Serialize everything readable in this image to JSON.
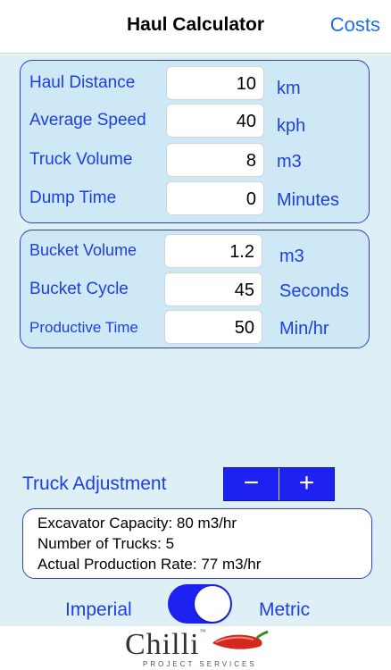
{
  "nav": {
    "title": "Haul Calculator",
    "right_button": "Costs"
  },
  "haul": {
    "distance": {
      "label": "Haul Distance",
      "value": "10",
      "unit": "km"
    },
    "speed": {
      "label": "Average Speed",
      "value": "40",
      "unit": "kph"
    },
    "truck_volume": {
      "label": "Truck Volume",
      "value": "8",
      "unit": "m3"
    },
    "dump_time": {
      "label": "Dump Time",
      "value": "0",
      "unit": "Minutes"
    }
  },
  "excavator": {
    "bucket_volume": {
      "label": "Bucket Volume",
      "value": "1.2",
      "unit": "m3"
    },
    "bucket_cycle": {
      "label": "Bucket Cycle",
      "value": "45",
      "unit": "Seconds"
    },
    "productive_time": {
      "label": "Productive Time",
      "value": "50",
      "unit": "Min/hr"
    }
  },
  "adjustment": {
    "label": "Truck Adjustment",
    "minus": "−",
    "plus": "+"
  },
  "results": {
    "excavator_capacity": "Excavator Capacity: 80 m3/hr",
    "number_of_trucks": "Number of Trucks: 5",
    "actual_production": "Actual Production Rate: 77 m3/hr"
  },
  "units_toggle": {
    "left_label": "Imperial",
    "right_label": "Metric",
    "state": "metric"
  },
  "footer": {
    "logo": "Chilli",
    "logo_tm": "™",
    "logo_sub": "PROJECT SERVICES"
  },
  "colors": {
    "accent": "#1d22f0",
    "label_blue": "#1f3ee0",
    "background": "#def0f6",
    "nav_link": "#1f6fe6",
    "pepper_red": "#d4271e"
  }
}
